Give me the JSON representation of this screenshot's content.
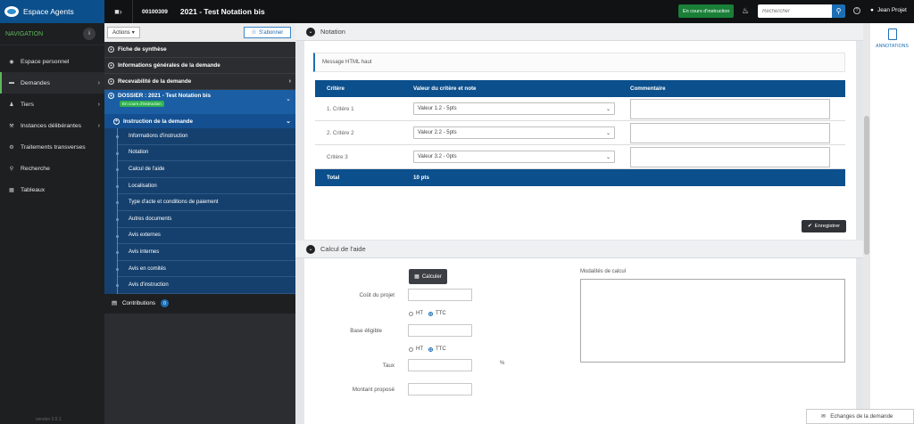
{
  "brand": {
    "name": "Espace Agents"
  },
  "topbar": {
    "dossier_number": "00100309",
    "dossier_title": "2021 - Test Notation bis",
    "status_button": "En cours d'instruction",
    "search_placeholder": "Rechercher",
    "user_name": "Jean Projet"
  },
  "nav": {
    "title": "NAVIGATION",
    "items": [
      {
        "label": "Espace personnel",
        "icon": "gauge-icon"
      },
      {
        "label": "Demandes",
        "icon": "folder-icon"
      },
      {
        "label": "Tiers",
        "icon": "users-icon"
      },
      {
        "label": "Instances délibérantes",
        "icon": "gavel-icon"
      },
      {
        "label": "Traitements transverses",
        "icon": "cogs-icon"
      },
      {
        "label": "Recherche",
        "icon": "search-icon"
      },
      {
        "label": "Tableaux",
        "icon": "table-icon"
      }
    ],
    "footer": "version 2.0.1"
  },
  "tree": {
    "actions_label": "Actions",
    "subscribe_label": "S'abonner",
    "sections": [
      "Fiche de synthèse",
      "Informations générales de la demande",
      "Recevabilité de la demande"
    ],
    "dossier_label": "DOSSIER : 2021 - Test Notation bis",
    "dossier_badge": "En cours d'instruction",
    "instruction_label": "Instruction de la demande",
    "sub_items": [
      "Informations d'instruction",
      "Notation",
      "Calcul de l'aide",
      "Localisation",
      "Type d'acte et conditions de paiement",
      "Autres documents",
      "Avis externes",
      "Avis internes",
      "Avis en comités",
      "Avis d'instruction"
    ],
    "contributions_label": "Contributions",
    "contributions_count": "0"
  },
  "notation": {
    "title": "Notation",
    "message": "Message HTML haut",
    "columns": [
      "Critère",
      "Valeur du critère et note",
      "Commentaire"
    ],
    "rows": [
      {
        "critere": "1. Critère 1",
        "valeur": "Valeur 1.2 - 5pts"
      },
      {
        "critere": "2. Critère 2",
        "valeur": "Valeur 2.2 - 5pts"
      },
      {
        "critere": "Critère 3",
        "valeur": "Valeur 3.2 - 0pts"
      }
    ],
    "total_label": "Total",
    "total_value": "10 pts",
    "save_label": "Enregistrer"
  },
  "calcul": {
    "title": "Calcul de l'aide",
    "calc_button": "Calculer",
    "fields": [
      "Coût du projet",
      "Base éligible",
      "Taux",
      "Montant proposé"
    ],
    "radio_ht": "HT",
    "radio_ttc": "TTC",
    "percent": "%",
    "modalites_label": "Modalités de calcul"
  },
  "annotations": {
    "label": "ANNOTATIONS"
  },
  "exchanges": {
    "label": "Echanges de la demande"
  },
  "colors": {
    "brand_blue": "#0b4f8c",
    "status_green": "#1a7f37",
    "nav_accent": "#5fb85c",
    "tree_active": "#1b5ea3"
  }
}
